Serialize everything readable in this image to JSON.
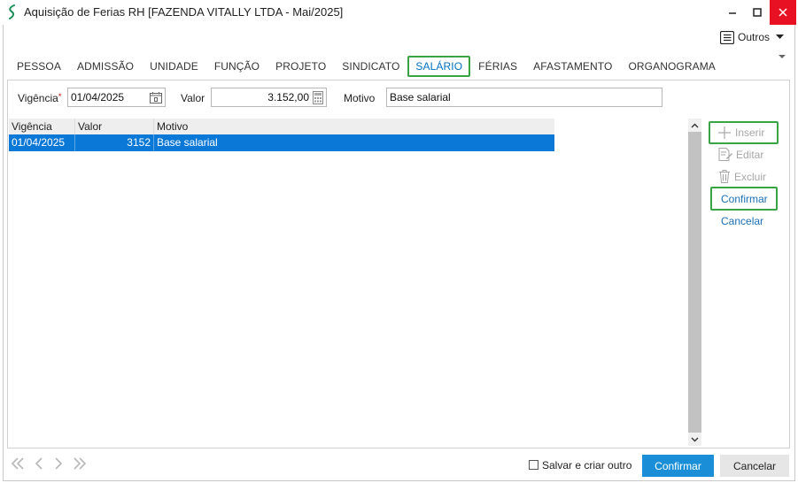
{
  "window": {
    "title": "Aquisição de Ferias RH [FAZENDA VITALLY LTDA - Mai/2025]"
  },
  "toolbar": {
    "outros_label": "Outros"
  },
  "tabs": [
    {
      "label": "PESSOA"
    },
    {
      "label": "ADMISSÃO"
    },
    {
      "label": "UNIDADE"
    },
    {
      "label": "FUNÇÃO"
    },
    {
      "label": "PROJETO"
    },
    {
      "label": "SINDICATO"
    },
    {
      "label": "SALÁRIO",
      "active": true
    },
    {
      "label": "FÉRIAS"
    },
    {
      "label": "AFASTAMENTO"
    },
    {
      "label": "ORGANOGRAMA"
    }
  ],
  "form": {
    "vigencia_label": "Vigência",
    "vigencia_value": "01/04/2025",
    "valor_label": "Valor",
    "valor_value": "3.152,00",
    "motivo_label": "Motivo",
    "motivo_value": "Base salarial"
  },
  "grid": {
    "columns": [
      "Vigência",
      "Valor",
      "Motivo"
    ],
    "rows": [
      {
        "vigencia": "01/04/2025",
        "valor": "3152",
        "motivo": "Base salarial"
      }
    ]
  },
  "actions": {
    "inserir": "Inserir",
    "editar": "Editar",
    "excluir": "Excluir",
    "confirmar": "Confirmar",
    "cancelar": "Cancelar"
  },
  "footer": {
    "save_create_label": "Salvar e criar outro",
    "confirm_button": "Confirmar",
    "cancel_button": "Cancelar"
  },
  "colors": {
    "accent": "#1a8fd8",
    "selection": "#0a78d6",
    "highlight": "#3aa346",
    "close": "#e81123"
  }
}
